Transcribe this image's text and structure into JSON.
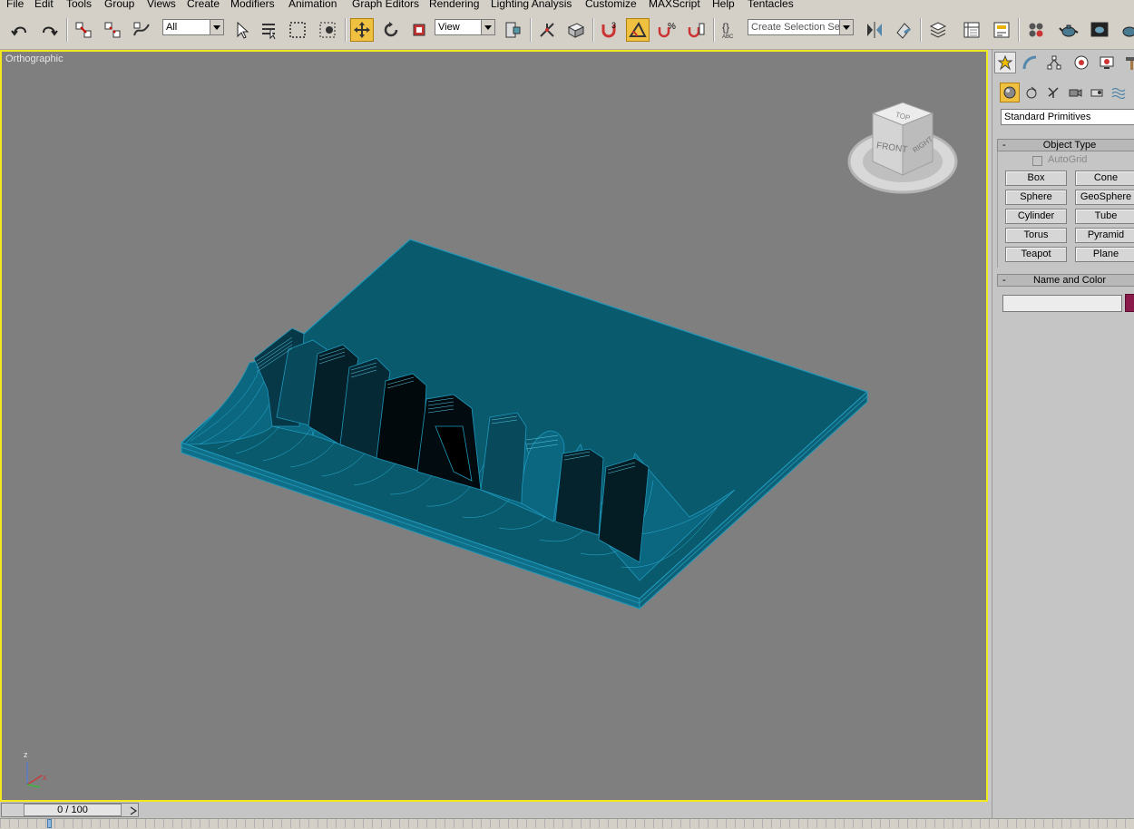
{
  "menu": {
    "items": [
      "File",
      "Edit",
      "Tools",
      "Group",
      "Views",
      "Create",
      "Modifiers",
      "Animation",
      "Graph Editors",
      "Rendering",
      "Lighting Analysis",
      "Customize",
      "MAXScript",
      "Help",
      "Tentacles"
    ]
  },
  "toolbar": {
    "selection_filter": "All",
    "reference_coord": "View",
    "named_selection_placeholder": "Create Selection Set",
    "snap_angle_label": "3"
  },
  "viewport": {
    "label": "Orthographic",
    "viewcube_faces": {
      "top": "TOP",
      "front": "FRONT",
      "right": "RIGHT"
    },
    "axis": {
      "x": "x",
      "z": "z"
    },
    "mesh_color": "#1f98bb",
    "background_color": "#7f7f7f",
    "active_border_color": "#f3e81f"
  },
  "command_panel": {
    "category": "Standard Primitives",
    "object_type": {
      "title": "Object Type",
      "autogrid_label": "AutoGrid",
      "buttons": [
        "Box",
        "Cone",
        "Sphere",
        "GeoSphere",
        "Cylinder",
        "Tube",
        "Torus",
        "Pyramid",
        "Teapot",
        "Plane"
      ]
    },
    "name_and_color": {
      "title": "Name and Color",
      "name_value": "",
      "color": "#8a1a4a"
    }
  },
  "timeline": {
    "frame_display": "0 / 100"
  }
}
